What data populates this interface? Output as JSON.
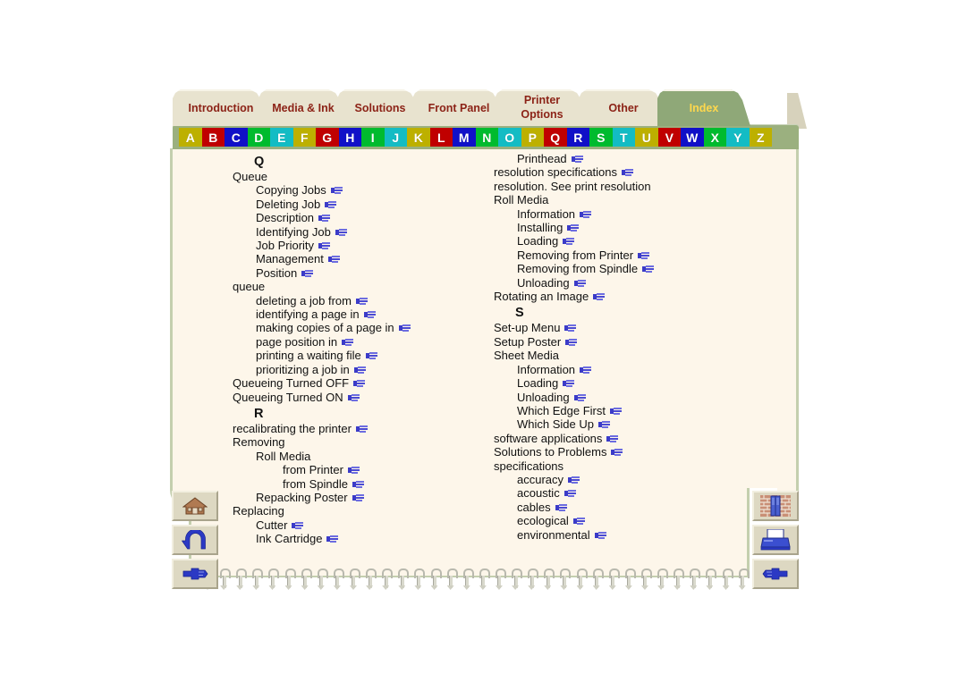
{
  "window": {
    "title": "Index"
  },
  "tabs": [
    {
      "label": "Introduction",
      "active": false,
      "lines": [
        "Introduction"
      ]
    },
    {
      "label": "Media & Ink",
      "active": false,
      "lines": [
        "Media & Ink"
      ]
    },
    {
      "label": "Solutions",
      "active": false,
      "lines": [
        "Solutions"
      ]
    },
    {
      "label": "Front Panel",
      "active": false,
      "lines": [
        "Front Panel"
      ]
    },
    {
      "label": "Printer Options",
      "active": false,
      "lines": [
        "Printer",
        "Options"
      ]
    },
    {
      "label": "Other",
      "active": false,
      "lines": [
        "Other"
      ]
    },
    {
      "label": "Index",
      "active": true,
      "lines": [
        "Index"
      ]
    }
  ],
  "alphabet": {
    "letters": [
      "A",
      "B",
      "C",
      "D",
      "E",
      "F",
      "G",
      "H",
      "I",
      "J",
      "K",
      "L",
      "M",
      "N",
      "O",
      "P",
      "Q",
      "R",
      "S",
      "T",
      "U",
      "V",
      "W",
      "X",
      "Y",
      "Z"
    ],
    "selected": "Q",
    "palette": [
      "#bdb000",
      "#c00000",
      "#1010c8",
      "#00bb2e",
      "#13bcc4"
    ],
    "bar_color": "#9bb07f"
  },
  "index": {
    "left_column": [
      {
        "type": "letter",
        "text": "Q"
      },
      {
        "type": "entry",
        "level": 0,
        "text": "Queue",
        "link": false
      },
      {
        "type": "entry",
        "level": 1,
        "text": "Copying Jobs",
        "link": true
      },
      {
        "type": "entry",
        "level": 1,
        "text": "Deleting Job",
        "link": true
      },
      {
        "type": "entry",
        "level": 1,
        "text": "Description",
        "link": true
      },
      {
        "type": "entry",
        "level": 1,
        "text": "Identifying Job",
        "link": true
      },
      {
        "type": "entry",
        "level": 1,
        "text": "Job Priority",
        "link": true
      },
      {
        "type": "entry",
        "level": 1,
        "text": "Management",
        "link": true
      },
      {
        "type": "entry",
        "level": 1,
        "text": "Position",
        "link": true
      },
      {
        "type": "entry",
        "level": 0,
        "text": "queue",
        "link": false
      },
      {
        "type": "entry",
        "level": 1,
        "text": "deleting a job from",
        "link": true
      },
      {
        "type": "entry",
        "level": 1,
        "text": "identifying a page in",
        "link": true
      },
      {
        "type": "entry",
        "level": 1,
        "text": "making copies of a page in",
        "link": true
      },
      {
        "type": "entry",
        "level": 1,
        "text": "page position in",
        "link": true
      },
      {
        "type": "entry",
        "level": 1,
        "text": "printing a waiting file",
        "link": true
      },
      {
        "type": "entry",
        "level": 1,
        "text": "prioritizing a job in",
        "link": true
      },
      {
        "type": "entry",
        "level": 0,
        "text": "Queueing Turned OFF",
        "link": true
      },
      {
        "type": "entry",
        "level": 0,
        "text": "Queueing Turned ON",
        "link": true
      },
      {
        "type": "letter",
        "text": "R"
      },
      {
        "type": "entry",
        "level": 0,
        "text": "recalibrating the printer",
        "link": true
      },
      {
        "type": "entry",
        "level": 0,
        "text": "Removing",
        "link": false
      },
      {
        "type": "entry",
        "level": 1,
        "text": "Roll Media",
        "link": false
      },
      {
        "type": "entry",
        "level": 2,
        "text": "from Printer",
        "link": true
      },
      {
        "type": "entry",
        "level": 2,
        "text": "from Spindle",
        "link": true
      },
      {
        "type": "entry",
        "level": 1,
        "text": "Repacking Poster",
        "link": true
      },
      {
        "type": "entry",
        "level": 0,
        "text": "Replacing",
        "link": false
      },
      {
        "type": "entry",
        "level": 1,
        "text": "Cutter",
        "link": true
      },
      {
        "type": "entry",
        "level": 1,
        "text": "Ink Cartridge",
        "link": true
      }
    ],
    "right_column": [
      {
        "type": "entry",
        "level": 1,
        "text": "Printhead",
        "link": true
      },
      {
        "type": "entry",
        "level": 0,
        "text": "resolution specifications",
        "link": true
      },
      {
        "type": "entry",
        "level": 0,
        "text": "resolution. See print resolution",
        "link": false
      },
      {
        "type": "entry",
        "level": 0,
        "text": "Roll Media",
        "link": false
      },
      {
        "type": "entry",
        "level": 1,
        "text": "Information",
        "link": true
      },
      {
        "type": "entry",
        "level": 1,
        "text": "Installing",
        "link": true
      },
      {
        "type": "entry",
        "level": 1,
        "text": "Loading",
        "link": true
      },
      {
        "type": "entry",
        "level": 1,
        "text": "Removing from Printer",
        "link": true
      },
      {
        "type": "entry",
        "level": 1,
        "text": "Removing from Spindle",
        "link": true
      },
      {
        "type": "entry",
        "level": 1,
        "text": "Unloading",
        "link": true
      },
      {
        "type": "entry",
        "level": 0,
        "text": "Rotating an Image",
        "link": true
      },
      {
        "type": "letter",
        "text": "S"
      },
      {
        "type": "entry",
        "level": 0,
        "text": "Set-up Menu",
        "link": true
      },
      {
        "type": "entry",
        "level": 0,
        "text": "Setup Poster",
        "link": true
      },
      {
        "type": "entry",
        "level": 0,
        "text": "Sheet Media",
        "link": false
      },
      {
        "type": "entry",
        "level": 1,
        "text": "Information",
        "link": true
      },
      {
        "type": "entry",
        "level": 1,
        "text": "Loading",
        "link": true
      },
      {
        "type": "entry",
        "level": 1,
        "text": "Unloading",
        "link": true
      },
      {
        "type": "entry",
        "level": 1,
        "text": "Which Edge First",
        "link": true
      },
      {
        "type": "entry",
        "level": 1,
        "text": "Which Side Up",
        "link": true
      },
      {
        "type": "entry",
        "level": 0,
        "text": "software applications",
        "link": true
      },
      {
        "type": "entry",
        "level": 0,
        "text": "Solutions to Problems",
        "link": true
      },
      {
        "type": "entry",
        "level": 0,
        "text": "specifications",
        "link": false
      },
      {
        "type": "entry",
        "level": 1,
        "text": "accuracy",
        "link": true
      },
      {
        "type": "entry",
        "level": 1,
        "text": "acoustic",
        "link": true
      },
      {
        "type": "entry",
        "level": 1,
        "text": "cables",
        "link": true
      },
      {
        "type": "entry",
        "level": 1,
        "text": "ecological",
        "link": true
      },
      {
        "type": "entry",
        "level": 1,
        "text": "environmental",
        "link": true
      }
    ]
  },
  "nav_left": [
    {
      "icon": "home-icon",
      "label": "Home"
    },
    {
      "icon": "back-arrow-icon",
      "label": "Back"
    },
    {
      "icon": "hand-right-icon",
      "label": "Next"
    }
  ],
  "nav_right": [
    {
      "icon": "bookcase-icon",
      "label": "Index"
    },
    {
      "icon": "printer-icon",
      "label": "Print"
    },
    {
      "icon": "hand-left-icon",
      "label": "Previous"
    }
  ],
  "colors": {
    "page": "#fdf6ea",
    "page_border": "#c4cfae",
    "tab_inactive_bg": "#e8e3cf",
    "tab_inactive_text": "#8c2317",
    "tab_active_bg": "#8fa878",
    "tab_active_text": "#ffd84d",
    "alpha_bar": "#9bb07f",
    "link_icon": "#3b3bc8"
  }
}
